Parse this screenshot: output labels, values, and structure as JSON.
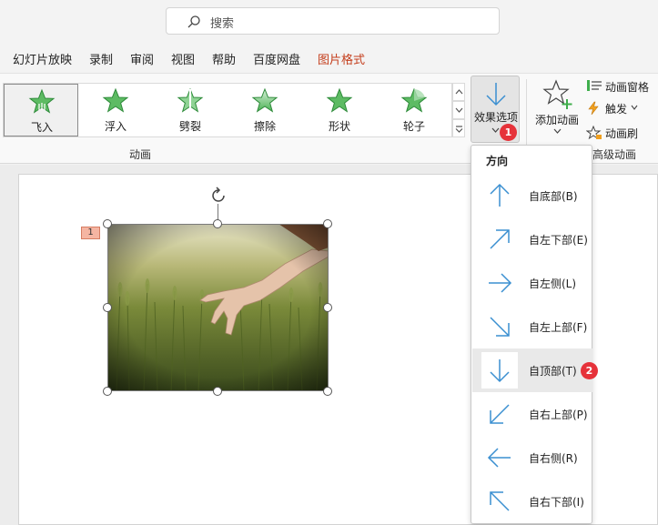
{
  "search": {
    "placeholder": "搜索",
    "icon": "search-icon"
  },
  "menu": {
    "items": [
      "幻灯片放映",
      "录制",
      "审阅",
      "视图",
      "帮助",
      "百度网盘",
      "图片格式"
    ],
    "active_index": 6,
    "active_color": "#c43e1c"
  },
  "ribbon": {
    "animations": [
      "飞入",
      "浮入",
      "劈裂",
      "擦除",
      "形状",
      "轮子"
    ],
    "selected_index": 0,
    "group_label_animation": "动画",
    "group_label_advanced": "高级动画",
    "effect_options": {
      "label": "效果选项",
      "badge": "1"
    },
    "add_animation": {
      "label": "添加动画"
    },
    "animation_pane": {
      "label": "动画窗格"
    },
    "trigger": {
      "label": "触发"
    },
    "animation_painter": {
      "label": "动画刷"
    },
    "star_color": "#3fae4c"
  },
  "slide": {
    "animation_tag": "1"
  },
  "dropdown": {
    "title": "方向",
    "items": [
      {
        "label": "自底部(B)",
        "arrow": "arrow-up-icon"
      },
      {
        "label": "自左下部(E)",
        "arrow": "arrow-up-right-icon"
      },
      {
        "label": "自左侧(L)",
        "arrow": "arrow-right-icon"
      },
      {
        "label": "自左上部(F)",
        "arrow": "arrow-down-right-icon"
      },
      {
        "label": "自顶部(T)",
        "arrow": "arrow-down-icon"
      },
      {
        "label": "自右上部(P)",
        "arrow": "arrow-down-left-icon"
      },
      {
        "label": "自右侧(R)",
        "arrow": "arrow-left-icon"
      },
      {
        "label": "自右下部(I)",
        "arrow": "arrow-up-left-icon"
      }
    ],
    "hover_index": 4,
    "hover_badge": "2",
    "arrow_color": "#3a8fd1"
  }
}
